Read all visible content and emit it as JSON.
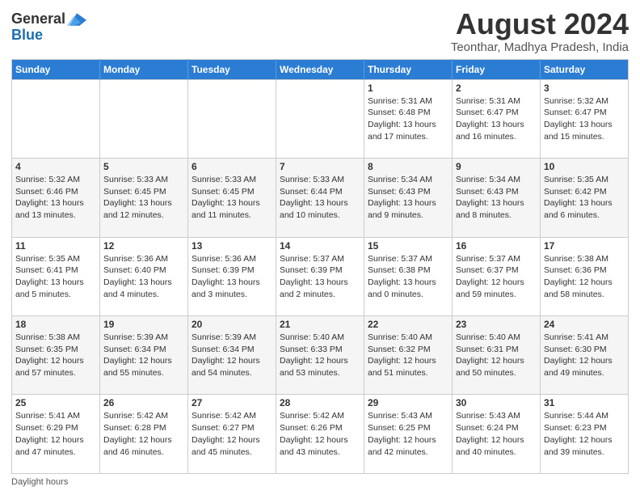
{
  "logo": {
    "general": "General",
    "blue": "Blue"
  },
  "title": "August 2024",
  "subtitle": "Teonthar, Madhya Pradesh, India",
  "days_of_week": [
    "Sunday",
    "Monday",
    "Tuesday",
    "Wednesday",
    "Thursday",
    "Friday",
    "Saturday"
  ],
  "weeks": [
    [
      {
        "day": "",
        "info": ""
      },
      {
        "day": "",
        "info": ""
      },
      {
        "day": "",
        "info": ""
      },
      {
        "day": "",
        "info": ""
      },
      {
        "day": "1",
        "info": "Sunrise: 5:31 AM\nSunset: 6:48 PM\nDaylight: 13 hours and 17 minutes."
      },
      {
        "day": "2",
        "info": "Sunrise: 5:31 AM\nSunset: 6:47 PM\nDaylight: 13 hours and 16 minutes."
      },
      {
        "day": "3",
        "info": "Sunrise: 5:32 AM\nSunset: 6:47 PM\nDaylight: 13 hours and 15 minutes."
      }
    ],
    [
      {
        "day": "4",
        "info": "Sunrise: 5:32 AM\nSunset: 6:46 PM\nDaylight: 13 hours and 13 minutes."
      },
      {
        "day": "5",
        "info": "Sunrise: 5:33 AM\nSunset: 6:45 PM\nDaylight: 13 hours and 12 minutes."
      },
      {
        "day": "6",
        "info": "Sunrise: 5:33 AM\nSunset: 6:45 PM\nDaylight: 13 hours and 11 minutes."
      },
      {
        "day": "7",
        "info": "Sunrise: 5:33 AM\nSunset: 6:44 PM\nDaylight: 13 hours and 10 minutes."
      },
      {
        "day": "8",
        "info": "Sunrise: 5:34 AM\nSunset: 6:43 PM\nDaylight: 13 hours and 9 minutes."
      },
      {
        "day": "9",
        "info": "Sunrise: 5:34 AM\nSunset: 6:43 PM\nDaylight: 13 hours and 8 minutes."
      },
      {
        "day": "10",
        "info": "Sunrise: 5:35 AM\nSunset: 6:42 PM\nDaylight: 13 hours and 6 minutes."
      }
    ],
    [
      {
        "day": "11",
        "info": "Sunrise: 5:35 AM\nSunset: 6:41 PM\nDaylight: 13 hours and 5 minutes."
      },
      {
        "day": "12",
        "info": "Sunrise: 5:36 AM\nSunset: 6:40 PM\nDaylight: 13 hours and 4 minutes."
      },
      {
        "day": "13",
        "info": "Sunrise: 5:36 AM\nSunset: 6:39 PM\nDaylight: 13 hours and 3 minutes."
      },
      {
        "day": "14",
        "info": "Sunrise: 5:37 AM\nSunset: 6:39 PM\nDaylight: 13 hours and 2 minutes."
      },
      {
        "day": "15",
        "info": "Sunrise: 5:37 AM\nSunset: 6:38 PM\nDaylight: 13 hours and 0 minutes."
      },
      {
        "day": "16",
        "info": "Sunrise: 5:37 AM\nSunset: 6:37 PM\nDaylight: 12 hours and 59 minutes."
      },
      {
        "day": "17",
        "info": "Sunrise: 5:38 AM\nSunset: 6:36 PM\nDaylight: 12 hours and 58 minutes."
      }
    ],
    [
      {
        "day": "18",
        "info": "Sunrise: 5:38 AM\nSunset: 6:35 PM\nDaylight: 12 hours and 57 minutes."
      },
      {
        "day": "19",
        "info": "Sunrise: 5:39 AM\nSunset: 6:34 PM\nDaylight: 12 hours and 55 minutes."
      },
      {
        "day": "20",
        "info": "Sunrise: 5:39 AM\nSunset: 6:34 PM\nDaylight: 12 hours and 54 minutes."
      },
      {
        "day": "21",
        "info": "Sunrise: 5:40 AM\nSunset: 6:33 PM\nDaylight: 12 hours and 53 minutes."
      },
      {
        "day": "22",
        "info": "Sunrise: 5:40 AM\nSunset: 6:32 PM\nDaylight: 12 hours and 51 minutes."
      },
      {
        "day": "23",
        "info": "Sunrise: 5:40 AM\nSunset: 6:31 PM\nDaylight: 12 hours and 50 minutes."
      },
      {
        "day": "24",
        "info": "Sunrise: 5:41 AM\nSunset: 6:30 PM\nDaylight: 12 hours and 49 minutes."
      }
    ],
    [
      {
        "day": "25",
        "info": "Sunrise: 5:41 AM\nSunset: 6:29 PM\nDaylight: 12 hours and 47 minutes."
      },
      {
        "day": "26",
        "info": "Sunrise: 5:42 AM\nSunset: 6:28 PM\nDaylight: 12 hours and 46 minutes."
      },
      {
        "day": "27",
        "info": "Sunrise: 5:42 AM\nSunset: 6:27 PM\nDaylight: 12 hours and 45 minutes."
      },
      {
        "day": "28",
        "info": "Sunrise: 5:42 AM\nSunset: 6:26 PM\nDaylight: 12 hours and 43 minutes."
      },
      {
        "day": "29",
        "info": "Sunrise: 5:43 AM\nSunset: 6:25 PM\nDaylight: 12 hours and 42 minutes."
      },
      {
        "day": "30",
        "info": "Sunrise: 5:43 AM\nSunset: 6:24 PM\nDaylight: 12 hours and 40 minutes."
      },
      {
        "day": "31",
        "info": "Sunrise: 5:44 AM\nSunset: 6:23 PM\nDaylight: 12 hours and 39 minutes."
      }
    ]
  ],
  "footer": "Daylight hours"
}
